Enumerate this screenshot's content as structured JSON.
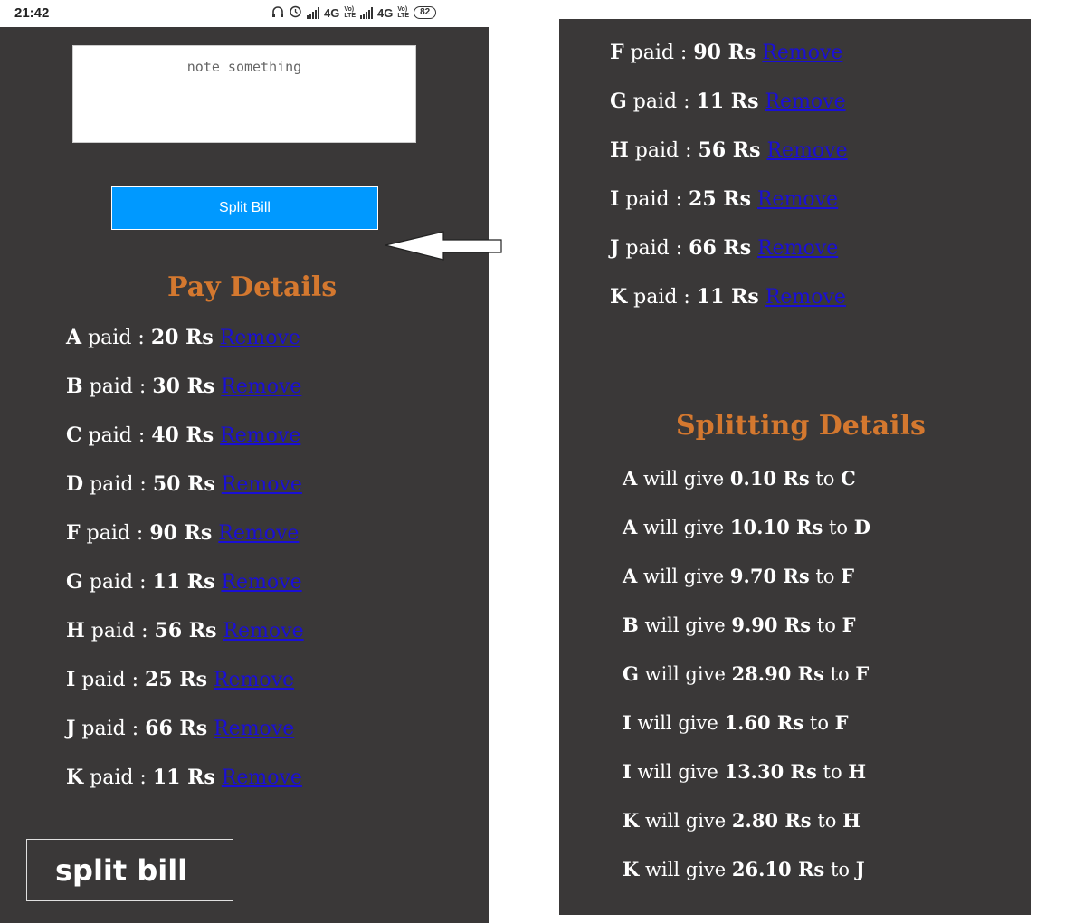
{
  "status_bar": {
    "time": "21:42",
    "network_1": "4G",
    "network_2": "4G",
    "volte_top": "Vo)",
    "volte_bottom": "LTE",
    "battery": "82",
    "icons": [
      "headphones-icon",
      "alarm-icon",
      "signal-icon",
      "signal-icon"
    ]
  },
  "note": {
    "placeholder": "note something"
  },
  "split_button": {
    "label": "Split Bill"
  },
  "pay_details": {
    "title": "Pay Details",
    "paid_word": "paid :",
    "currency": "Rs",
    "remove_label": "Remove ",
    "items": [
      {
        "name": "A",
        "amount": "20"
      },
      {
        "name": "B",
        "amount": "30"
      },
      {
        "name": "C",
        "amount": "40"
      },
      {
        "name": "D",
        "amount": "50"
      },
      {
        "name": "F",
        "amount": "90"
      },
      {
        "name": "G",
        "amount": "11"
      },
      {
        "name": "H",
        "amount": "56"
      },
      {
        "name": "I",
        "amount": "25"
      },
      {
        "name": "J",
        "amount": "66"
      },
      {
        "name": "K",
        "amount": "11"
      }
    ],
    "continued_items": [
      {
        "name": "F",
        "amount": "90"
      },
      {
        "name": "G",
        "amount": "11"
      },
      {
        "name": "H",
        "amount": "56"
      },
      {
        "name": "I",
        "amount": "25"
      },
      {
        "name": "J",
        "amount": "66"
      },
      {
        "name": "K",
        "amount": "11"
      }
    ]
  },
  "caption": {
    "label": "split bill"
  },
  "splitting_details": {
    "title": "Splitting Details",
    "give_word": "will give",
    "to_word": "to",
    "currency": "Rs",
    "items": [
      {
        "from": "A",
        "amount": "0.10",
        "to": "C"
      },
      {
        "from": "A",
        "amount": "10.10",
        "to": "D"
      },
      {
        "from": "A",
        "amount": "9.70",
        "to": "F"
      },
      {
        "from": "B",
        "amount": "9.90",
        "to": "F"
      },
      {
        "from": "G",
        "amount": "28.90",
        "to": "F"
      },
      {
        "from": "I",
        "amount": "1.60",
        "to": "F"
      },
      {
        "from": "I",
        "amount": "13.30",
        "to": "H"
      },
      {
        "from": "K",
        "amount": "2.80",
        "to": "H"
      },
      {
        "from": "K",
        "amount": "26.10",
        "to": "J"
      }
    ]
  },
  "colors": {
    "panel_bg": "#3a3838",
    "button_bg": "#0099ff",
    "title": "#d4782f",
    "remove_link": "#1a0fd6",
    "text": "#ffffff"
  }
}
